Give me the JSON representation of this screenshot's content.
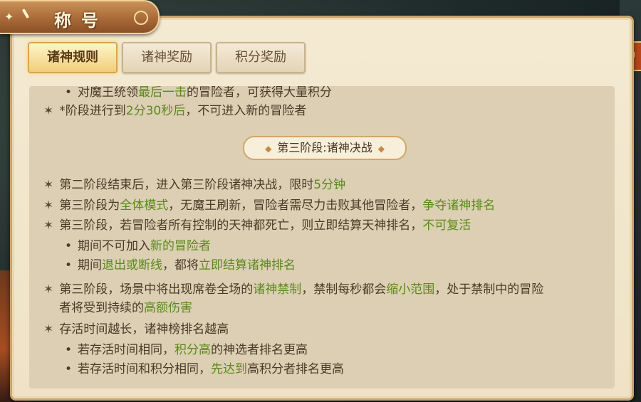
{
  "title": "称号",
  "tabs": [
    {
      "label": "诸神规则",
      "active": true
    },
    {
      "label": "诸神奖励",
      "active": false
    },
    {
      "label": "积分奖励",
      "active": false
    }
  ],
  "stage_header": "第三阶段:诸神决战",
  "lines": {
    "l0": {
      "bullet": "•",
      "p1": "对魔王统领",
      "g1": "最后一击",
      "p2": "的冒险者，可获得大量积分"
    },
    "l1": {
      "bullet": "✶",
      "p1": "*阶段进行到",
      "g1": "2分30秒后",
      "p2": "，不可进入新的冒险者"
    },
    "l2": {
      "bullet": "✶",
      "p1": "第二阶段结束后，进入第三阶段诸神决战，限时",
      "g1": "5分钟"
    },
    "l3": {
      "bullet": "✶",
      "p1": "第三阶段为",
      "g1": "全体模式",
      "p2": "，无魔王刷新，冒险者需尽力击败其他冒险者，",
      "g2": "争夺诸神排名"
    },
    "l4": {
      "bullet": "✶",
      "p1": "第三阶段，若冒险者所有控制的天神都死亡，则立即结算天神排名，",
      "g1": "不可复活"
    },
    "l5": {
      "bullet": "•",
      "p1": "期间不可加入",
      "g1": "新的冒险者"
    },
    "l6": {
      "bullet": "•",
      "p1": "期间",
      "g1": "退出或断线",
      "p2": "，都将",
      "g2": "立即结算诸神排名"
    },
    "l7": {
      "bullet": "✶",
      "p1": "第三阶段，场景中将出现席卷全场的",
      "g1": "诸神禁制",
      "p2": "，禁制每秒都会",
      "g2": "缩小范围",
      "p3": "，处于禁制中的冒险"
    },
    "l8": {
      "p1": "者将受到持续的",
      "g1": "高额伤害"
    },
    "l9": {
      "bullet": "✶",
      "p1": "存活时间越长，诸神榜排名越高"
    },
    "l10": {
      "bullet": "•",
      "p1": "若存活时间相同，",
      "g1": "积分高",
      "p2": "的神选者排名更高"
    },
    "l11": {
      "bullet": "•",
      "p1": "若存活时间和积分相同，",
      "g1": "先达到",
      "p2": "高积分者排名更高"
    }
  },
  "close_icon": "◂",
  "colors": {
    "highlight": "#5a8a1a",
    "text": "#4a3a28"
  }
}
